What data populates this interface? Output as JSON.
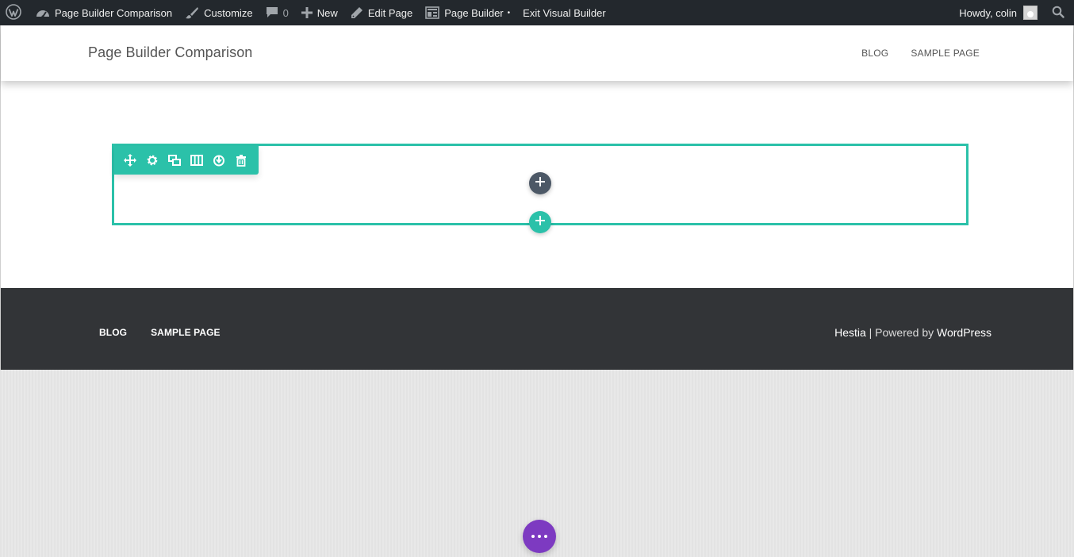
{
  "adminbar": {
    "site_name": "Page Builder Comparison",
    "customize": "Customize",
    "comments_count": "0",
    "new": "New",
    "edit_page": "Edit Page",
    "page_builder": "Page Builder",
    "page_builder_dot": "•",
    "exit_builder": "Exit Visual Builder",
    "howdy": "Howdy, colin"
  },
  "header": {
    "site_title": "Page Builder Comparison",
    "nav": [
      "BLOG",
      "SAMPLE PAGE"
    ]
  },
  "section": {
    "toolbar_icons": [
      "move-icon",
      "settings-icon",
      "duplicate-icon",
      "columns-icon",
      "save-icon",
      "delete-icon"
    ],
    "add_module_icon": "plus-icon",
    "add_section_icon": "plus-icon"
  },
  "footer": {
    "nav": [
      "BLOG",
      "SAMPLE PAGE"
    ],
    "credit_theme": "Hestia",
    "credit_sep": " | Powered by ",
    "credit_wp": "WordPress"
  },
  "colors": {
    "adminbar_bg": "#23282d",
    "builder_accent": "#2bc1a9",
    "module_button": "#4c5866",
    "footer_bg": "#323437",
    "fab": "#7d3ac1"
  }
}
